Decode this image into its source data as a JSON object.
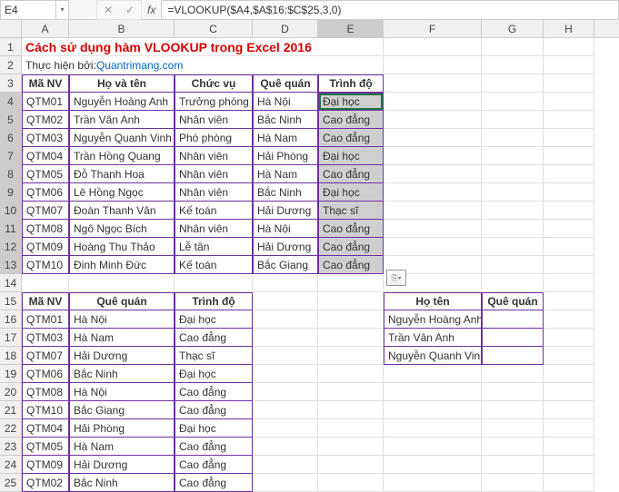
{
  "formula_bar": {
    "name_box": "E4",
    "cancel": "✕",
    "enter": "✓",
    "fx": "fx",
    "formula": "=VLOOKUP($A4,$A$16:$C$25,3,0)"
  },
  "columns": [
    "A",
    "B",
    "C",
    "D",
    "E",
    "F",
    "G",
    "H"
  ],
  "row_count": 25,
  "title": "Cách sử dụng hàm VLOOKUP trong Excel 2016",
  "subtitle": {
    "prefix": "Thực hiện bởi: ",
    "link": "Quantrimang.com"
  },
  "table1": {
    "headers": [
      "Mã NV",
      "Họ và tên",
      "Chức vụ",
      "Quê quán",
      "Trình độ"
    ],
    "rows": [
      [
        "QTM01",
        "Nguyễn Hoàng Anh",
        "Trưởng phòng",
        "Hà Nội",
        "Đại học"
      ],
      [
        "QTM02",
        "Trần Vân Anh",
        "Nhân viên",
        "Bắc Ninh",
        "Cao đẳng"
      ],
      [
        "QTM03",
        "Nguyễn Quanh Vinh",
        "Phó phòng",
        "Hà Nam",
        "Cao đẳng"
      ],
      [
        "QTM04",
        "Trần Hồng Quang",
        "Nhân viên",
        "Hải Phòng",
        "Đại học"
      ],
      [
        "QTM05",
        "Đỗ Thanh Hoa",
        "Nhân viên",
        "Hà Nam",
        "Cao đẳng"
      ],
      [
        "QTM06",
        "Lê Hồng Ngọc",
        "Nhân viên",
        "Bắc Ninh",
        "Đại học"
      ],
      [
        "QTM07",
        "Đoàn Thanh Vân",
        "Kế toán",
        "Hải Dương",
        "Thạc sĩ"
      ],
      [
        "QTM08",
        "Ngô Ngọc Bích",
        "Nhân viên",
        "Hà Nội",
        "Cao đẳng"
      ],
      [
        "QTM09",
        "Hoàng Thu Thảo",
        "Lễ tân",
        "Hải Dương",
        "Cao đẳng"
      ],
      [
        "QTM10",
        "Đinh Minh Đức",
        "Kế toán",
        "Bắc Giang",
        "Cao đẳng"
      ]
    ]
  },
  "table2": {
    "headers": [
      "Mã NV",
      "Quê quán",
      "Trình độ"
    ],
    "rows": [
      [
        "QTM01",
        "Hà Nội",
        "Đại học"
      ],
      [
        "QTM03",
        "Hà Nam",
        "Cao đẳng"
      ],
      [
        "QTM07",
        "Hải Dương",
        "Thạc sĩ"
      ],
      [
        "QTM06",
        "Bắc Ninh",
        "Đại học"
      ],
      [
        "QTM08",
        "Hà Nội",
        "Cao đẳng"
      ],
      [
        "QTM10",
        "Bắc Giang",
        "Cao đẳng"
      ],
      [
        "QTM04",
        "Hải Phòng",
        "Đại học"
      ],
      [
        "QTM05",
        "Hà Nam",
        "Cao đẳng"
      ],
      [
        "QTM09",
        "Hải Dương",
        "Cao đẳng"
      ],
      [
        "QTM02",
        "Bắc Ninh",
        "Cao đẳng"
      ]
    ]
  },
  "table3": {
    "headers": [
      "Họ tên",
      "Quê quán"
    ],
    "rows": [
      [
        "Nguyễn Hoàng Anh",
        ""
      ],
      [
        "Trần Vân Anh",
        ""
      ],
      [
        "Nguyễn Quanh Vinh",
        ""
      ]
    ]
  },
  "paste_hint": "⎘▾"
}
